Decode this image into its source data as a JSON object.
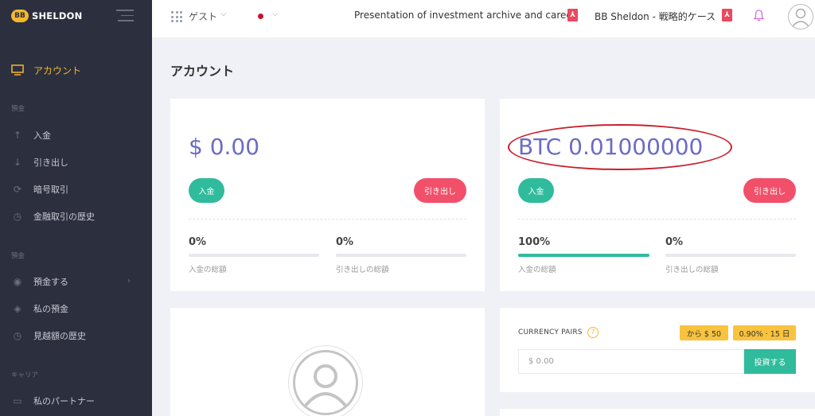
{
  "brand": {
    "logo_text": "BB",
    "name": "SHELDON"
  },
  "sidebar": {
    "active_item": {
      "label": "アカウント",
      "icon": "monitor-icon"
    },
    "sections": [
      {
        "title": "預金",
        "items": [
          {
            "label": "入金",
            "icon": "arrow-up-icon"
          },
          {
            "label": "引き出し",
            "icon": "arrow-down-icon"
          },
          {
            "label": "暗号取引",
            "icon": "exchange-icon"
          },
          {
            "label": "金融取引の歴史",
            "icon": "history-icon"
          }
        ]
      },
      {
        "title": "預金",
        "items": [
          {
            "label": "預金する",
            "icon": "piggy-bank-icon"
          },
          {
            "label": "私の預金",
            "icon": "layers-icon"
          },
          {
            "label": "見越額の歴史",
            "icon": "history-icon"
          }
        ]
      },
      {
        "title": "キャリア",
        "items": [
          {
            "label": "私のパートナー",
            "icon": "folder-icon"
          }
        ]
      }
    ]
  },
  "topbar": {
    "guest_label": "ゲスト",
    "presentation_link": "Presentation of investment archive and career",
    "strategy_link": "BB Sheldon - 戦略的ケース",
    "pdf_icon_text": "⅄"
  },
  "main": {
    "page_title": "アカウント",
    "usd_card": {
      "amount": "$ 0.00",
      "deposit_label": "入金",
      "withdraw_label": "引き出し",
      "deposit_pct": "0%",
      "deposit_pct_value": 0,
      "deposit_total_label": "入金の総額",
      "withdraw_pct": "0%",
      "withdraw_pct_value": 0,
      "withdraw_total_label": "引き出しの総額"
    },
    "btc_card": {
      "amount": "BTC 0.01000000",
      "deposit_label": "入金",
      "withdraw_label": "引き出し",
      "deposit_pct": "100%",
      "deposit_pct_value": 100,
      "deposit_total_label": "入金の総額",
      "withdraw_pct": "0%",
      "withdraw_pct_value": 0,
      "withdraw_total_label": "引き出しの総額"
    },
    "currency_pairs": {
      "label": "CURRENCY PAIRS",
      "help": "?",
      "min_badge": "から $ 50",
      "rate_badge": "0.90% · 15 日",
      "input_placeholder": "$ 0.00",
      "invest_label": "投資する"
    }
  },
  "colors": {
    "accent": "#f4b82e",
    "sidebar_bg": "#2c2f3d",
    "green": "#30bb9c",
    "red": "#f2506a",
    "amount": "#6c6cc4"
  }
}
